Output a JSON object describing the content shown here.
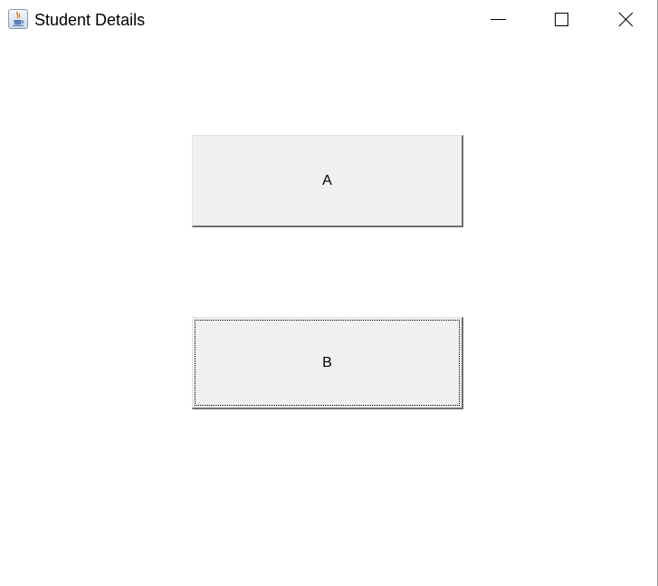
{
  "window": {
    "title": "Student Details",
    "app_icon": "java-cup-icon",
    "controls": {
      "minimize_icon": "minimize-icon",
      "maximize_icon": "maximize-icon",
      "close_icon": "close-icon"
    }
  },
  "buttons": {
    "a_label": "A",
    "b_label": "B",
    "focused": "B"
  },
  "colors": {
    "button_face": "#f0f0f0",
    "button_shadow": "#6f6f6f",
    "window_background": "#ffffff"
  }
}
